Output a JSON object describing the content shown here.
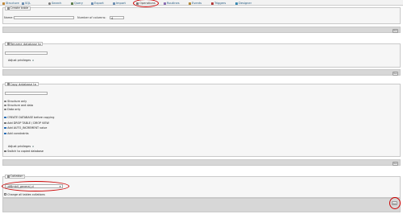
{
  "tabs": [
    {
      "label": "Structure",
      "icon": "table-structure-icon",
      "color": "#c0883a"
    },
    {
      "label": "SQL",
      "icon": "sql-icon",
      "color": "#6d8fb3"
    },
    {
      "label": "Search",
      "icon": "search-icon",
      "color": "#7a7a7a"
    },
    {
      "label": "Query",
      "icon": "query-icon",
      "color": "#5d7f4f"
    },
    {
      "label": "Export",
      "icon": "export-icon",
      "color": "#6d8fb3"
    },
    {
      "label": "Import",
      "icon": "import-icon",
      "color": "#6d8fb3"
    },
    {
      "label": "Operations",
      "icon": "wrench-icon",
      "color": "#7a7a7a"
    },
    {
      "label": "Routines",
      "icon": "routines-icon",
      "color": "#8a6db3"
    },
    {
      "label": "Events",
      "icon": "events-icon",
      "color": "#b38a3a"
    },
    {
      "label": "Triggers",
      "icon": "triggers-icon",
      "color": "#b33a3a"
    },
    {
      "label": "Designer",
      "icon": "designer-icon",
      "color": "#3a8ab3"
    }
  ],
  "create_table": {
    "legend": "Create table",
    "name_label": "Name:",
    "name_value": "",
    "columns_label": "Number of columns:",
    "columns_value": "4",
    "go": "Go"
  },
  "rename_db": {
    "legend": "Rename database to",
    "value": "",
    "adjust_privileges": "Adjust privileges",
    "go": "Go"
  },
  "copy_db": {
    "legend": "Copy database to",
    "value": "",
    "radios": [
      {
        "label": "Structure only",
        "checked": false
      },
      {
        "label": "Structure and data",
        "checked": true
      },
      {
        "label": "Data only",
        "checked": false
      }
    ],
    "checks": [
      {
        "label": "CREATE DATABASE before copying",
        "checked": true
      },
      {
        "label": "Add DROP TABLE / DROP VIEW",
        "checked": false
      },
      {
        "label": "Add AUTO_INCREMENT value",
        "checked": true
      },
      {
        "label": "Add constraints",
        "checked": true
      }
    ],
    "adjust_privileges": "Adjust privileges",
    "switch_label": "Switch to copied database",
    "go": "Go"
  },
  "collation": {
    "legend": "Collation",
    "selected": "utf8mb4_general_ci",
    "change_all": "Change all tables collations",
    "go": "Go"
  }
}
